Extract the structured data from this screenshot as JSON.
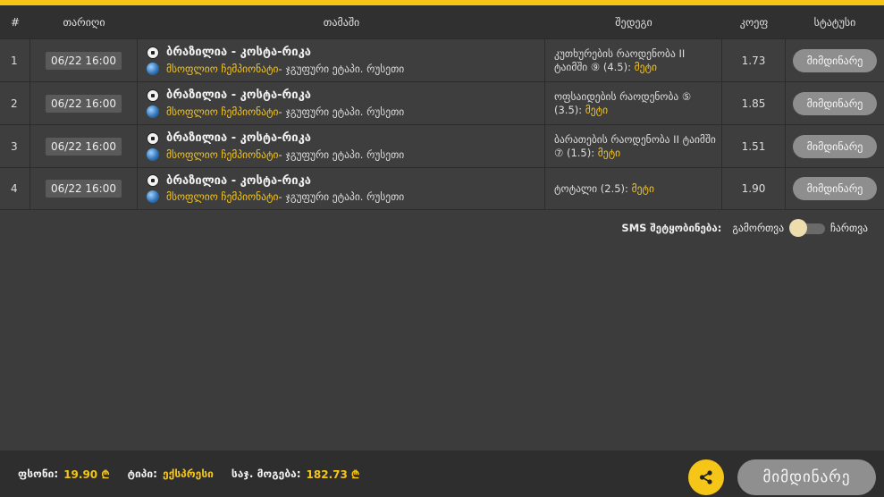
{
  "colors": {
    "accent": "#f5c518",
    "row_bg": "#3e3e3e",
    "header_bg": "#303030",
    "pill": "#8e8e8e"
  },
  "header": {
    "num": "#",
    "date": "თარიღი",
    "game": "თამაში",
    "outcome": "შედეგი",
    "odds": "კოეფ",
    "status": "სტატუსი"
  },
  "rows": [
    {
      "num": "1",
      "date": "06/22 16:00",
      "match": "ბრაზილია - კოსტა-რიკა",
      "tournament": "მსოფლიო ჩემპიონატი",
      "stage": "ჯგუფური ეტაპი. რუსეთი",
      "outcome_text": "კუთხურების რაოდენობა II ტაიმში ⑨ (4.5):",
      "pick": "მეტი",
      "odds": "1.73",
      "status": "მიმდინარე"
    },
    {
      "num": "2",
      "date": "06/22 16:00",
      "match": "ბრაზილია - კოსტა-რიკა",
      "tournament": "მსოფლიო ჩემპიონატი",
      "stage": "ჯგუფური ეტაპი. რუსეთი",
      "outcome_text": "ოფსაიდების რაოდენობა ⑤ (3.5):",
      "pick": "მეტი",
      "odds": "1.85",
      "status": "მიმდინარე"
    },
    {
      "num": "3",
      "date": "06/22 16:00",
      "match": "ბრაზილია - კოსტა-რიკა",
      "tournament": "მსოფლიო ჩემპიონატი",
      "stage": "ჯგუფური ეტაპი. რუსეთი",
      "outcome_text": "ბარათების რაოდენობა II ტაიმში ⑦ (1.5):",
      "pick": "მეტი",
      "odds": "1.51",
      "status": "მიმდინარე"
    },
    {
      "num": "4",
      "date": "06/22 16:00",
      "match": "ბრაზილია - კოსტა-რიკა",
      "tournament": "მსოფლიო ჩემპიონატი",
      "stage": "ჯგუფური ეტაპი. რუსეთი",
      "outcome_text": "ტოტალი (2.5):",
      "pick": "მეტი",
      "odds": "1.90",
      "status": "მიმდინარე"
    }
  ],
  "sms": {
    "label": "SMS შეტყობინება:",
    "off_label": "გამორთვა",
    "on_label": "ჩართვა",
    "enabled": false
  },
  "footer": {
    "stake_label": "ფსონი:",
    "stake_value": "19.90 ₾",
    "type_label": "ტიპი:",
    "type_value": "ექსპრესი",
    "winnings_label": "საჯ. მოგება:",
    "winnings_value": "182.73 ₾",
    "share_icon": "share-icon",
    "status_label": "მიმდინარე"
  },
  "separator": " - "
}
